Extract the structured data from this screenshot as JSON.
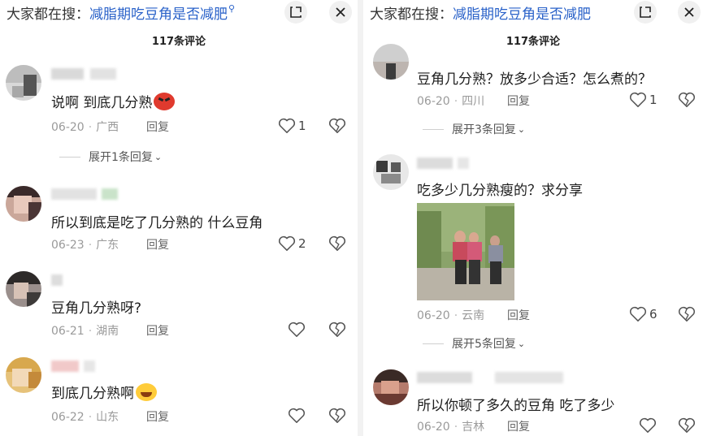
{
  "search": {
    "prefix": "大家都在搜：",
    "left_term": "减脂期吃豆角是否减肥",
    "right_term": "减脂期吃豆角是否减肥"
  },
  "header": {
    "comment_count": "117条评论"
  },
  "actions": {
    "reply": "回复"
  },
  "left_comments": [
    {
      "text": "说啊  到底几分熟",
      "date": "06-20",
      "location": "广西",
      "likes": "1",
      "emoji": "angry-face"
    },
    {
      "text": "所以到底是吃了几分熟的  什么豆角",
      "date": "06-23",
      "location": "广东",
      "likes": "2"
    },
    {
      "text": "豆角几分熟呀?",
      "date": "06-21",
      "location": "湖南",
      "likes": ""
    },
    {
      "text": "到底几分熟啊",
      "date": "06-22",
      "location": "山东",
      "likes": "",
      "emoji": "laughing-tears-face"
    }
  ],
  "left_expand": {
    "label": "展开1条回复"
  },
  "right_comments": [
    {
      "text": "豆角几分熟？放多少合适？怎么煮的？",
      "date": "06-20",
      "location": "四川",
      "likes": "1"
    },
    {
      "text": "吃多少几分熟瘦的？求分享",
      "date": "06-20",
      "location": "云南",
      "likes": "6"
    },
    {
      "text": "所以你顿了多久的豆角  吃了多少",
      "date": "06-20",
      "location": "吉林",
      "likes": ""
    }
  ],
  "right_expand_1": {
    "label": "展开3条回复"
  },
  "right_expand_2": {
    "label": "展开5条回复"
  },
  "colors": {
    "accent": "#2a62c9",
    "meta": "#9a9a9a"
  },
  "icons": [
    "search-icon",
    "pip-icon",
    "close-icon",
    "heart-icon",
    "dislike-heart-icon",
    "chevron-down-icon"
  ]
}
